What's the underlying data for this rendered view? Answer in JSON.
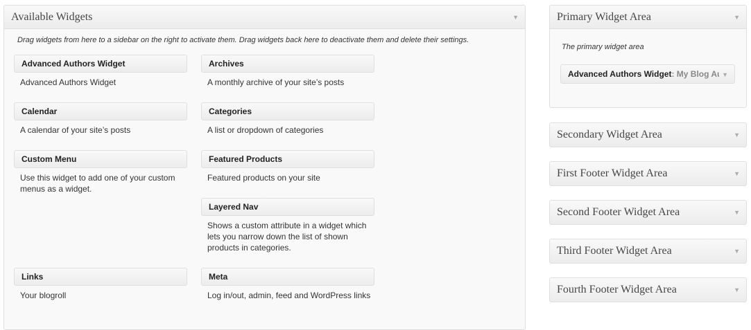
{
  "available": {
    "title": "Available Widgets",
    "description": "Drag widgets from here to a sidebar on the right to activate them. Drag widgets back here to deactivate them and delete their settings.",
    "widgets": [
      {
        "title": "Advanced Authors Widget",
        "desc": "Advanced Authors Widget"
      },
      {
        "title": "Archives",
        "desc": "A monthly archive of your site’s posts"
      },
      {
        "title": "Calendar",
        "desc": "A calendar of your site’s posts"
      },
      {
        "title": "Categories",
        "desc": "A list or dropdown of categories"
      },
      {
        "title": "Custom Menu",
        "desc": "Use this widget to add one of your custom menus as a widget."
      },
      {
        "title": "Featured Products",
        "desc": "Featured products on your site"
      },
      {
        "title": "Layered Nav",
        "desc": "Shows a custom attribute in a widget which lets you narrow down the list of shown products in categories."
      },
      {
        "title": "Links",
        "desc": "Your blogroll"
      },
      {
        "title": "Meta",
        "desc": "Log in/out, admin, feed and WordPress links"
      }
    ]
  },
  "sidebars": {
    "primary": {
      "title": "Primary Widget Area",
      "description": "The primary widget area",
      "widget": {
        "title": "Advanced Authors Widget",
        "subtitle": ": My Blog Authors"
      }
    },
    "others": [
      {
        "title": "Secondary Widget Area"
      },
      {
        "title": "First Footer Widget Area"
      },
      {
        "title": "Second Footer Widget Area"
      },
      {
        "title": "Third Footer Widget Area"
      },
      {
        "title": "Fourth Footer Widget Area"
      }
    ]
  },
  "icons": {
    "toggle": "caret-down-icon"
  }
}
